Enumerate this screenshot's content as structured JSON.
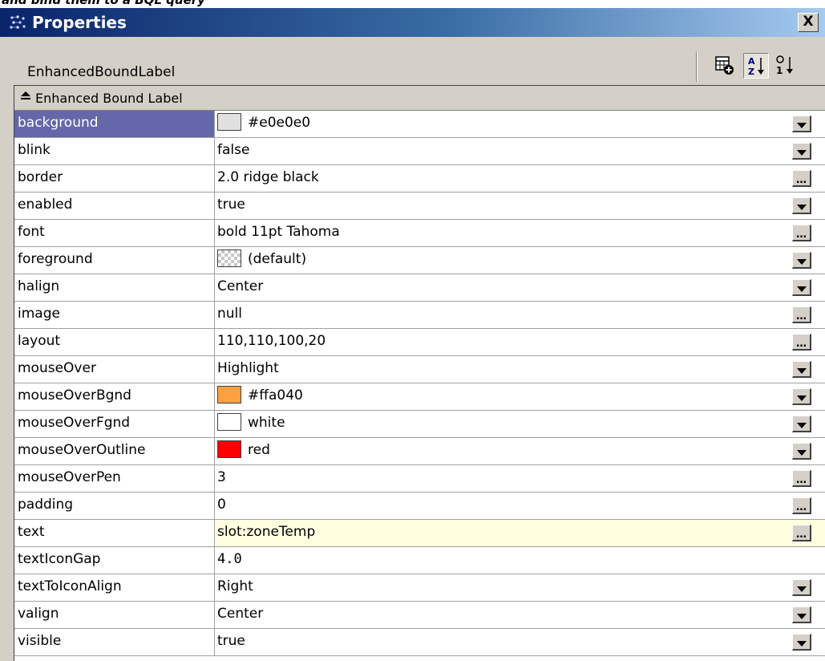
{
  "window": {
    "background_header_text": "and bind them to a BQL query",
    "title": "Properties",
    "close_label": "X"
  },
  "header": {
    "component_name": "EnhancedBoundLabel",
    "toolbar": {
      "new_icon": "add-component-icon",
      "sort_az_icon": "sort-alpha-icon",
      "sort_order_icon": "sort-order-icon",
      "active": "sort-alpha-icon"
    }
  },
  "group": {
    "toggle": "≛",
    "label": "Enhanced Bound Label",
    "expanded": true
  },
  "properties": [
    {
      "name": "background",
      "value": "#e0e0e0",
      "swatch": "#e0e0e0",
      "editor": "dropdown",
      "selected": true
    },
    {
      "name": "blink",
      "value": "false",
      "editor": "dropdown"
    },
    {
      "name": "border",
      "value": "2.0 ridge black",
      "editor": "dialog"
    },
    {
      "name": "enabled",
      "value": "true",
      "editor": "dropdown"
    },
    {
      "name": "font",
      "value": "bold 11pt Tahoma",
      "editor": "dialog"
    },
    {
      "name": "foreground",
      "value": "(default)",
      "swatch": "checker",
      "editor": "dropdown"
    },
    {
      "name": "halign",
      "value": "Center",
      "editor": "dropdown"
    },
    {
      "name": "image",
      "value": "null",
      "editor": "dialog"
    },
    {
      "name": "layout",
      "value": "110,110,100,20",
      "editor": "dialog"
    },
    {
      "name": "mouseOver",
      "value": "Highlight",
      "editor": "dropdown"
    },
    {
      "name": "mouseOverBgnd",
      "value": "#ffa040",
      "swatch": "#ffa040",
      "editor": "dropdown"
    },
    {
      "name": "mouseOverFgnd",
      "value": "white",
      "swatch": "#ffffff",
      "editor": "dropdown"
    },
    {
      "name": "mouseOverOutline",
      "value": "red",
      "swatch": "#ff0000",
      "editor": "dropdown"
    },
    {
      "name": "mouseOverPen",
      "value": "3",
      "editor": "dialog"
    },
    {
      "name": "padding",
      "value": "0",
      "editor": "dialog"
    },
    {
      "name": "text",
      "value": "slot:zoneTemp",
      "editor": "dialog",
      "highlighted": true
    },
    {
      "name": "textIconGap",
      "value": "4.0",
      "editor": "none",
      "monospace": true
    },
    {
      "name": "textToIconAlign",
      "value": "Right",
      "editor": "dropdown"
    },
    {
      "name": "valign",
      "value": "Center",
      "editor": "dropdown"
    },
    {
      "name": "visible",
      "value": "true",
      "editor": "dropdown"
    }
  ],
  "colors": {
    "titlebar_start": "#0a246a",
    "titlebar_end": "#a6caf0",
    "selected_row": "#6666aa",
    "highlight_row": "#ffffe0",
    "chrome": "#d4d0c8"
  }
}
